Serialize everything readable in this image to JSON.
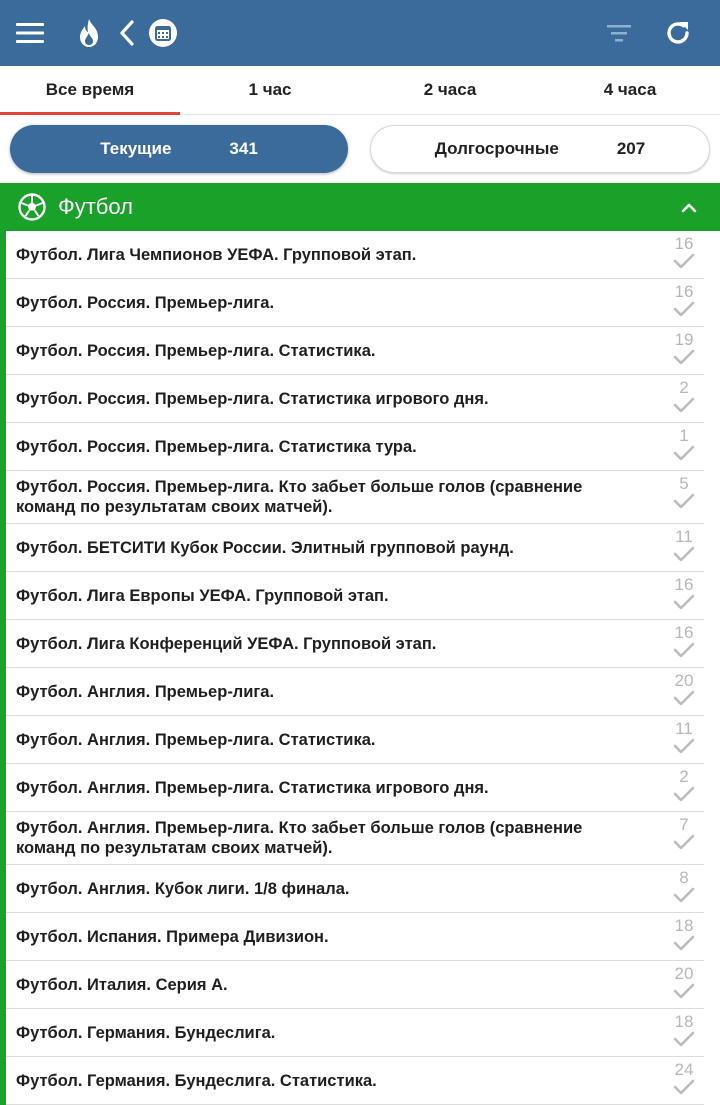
{
  "colors": {
    "header": "#3a6b9a",
    "sport": "#1aa12a",
    "accent": "#e0443a"
  },
  "topbar": {
    "icons": [
      "menu-icon",
      "flame-icon",
      "back-chevron-icon",
      "calendar-icon",
      "filter-icon",
      "refresh-icon"
    ]
  },
  "time_tabs": [
    {
      "label": "Все время",
      "active": true
    },
    {
      "label": "1 час",
      "active": false
    },
    {
      "label": "2 часа",
      "active": false
    },
    {
      "label": "4 часа",
      "active": false
    }
  ],
  "segments": [
    {
      "label": "Текущие",
      "count": "341",
      "active": true
    },
    {
      "label": "Долгосрочные",
      "count": "207",
      "active": false
    }
  ],
  "sport": {
    "name": "Футбол",
    "icon": "soccer-ball-icon",
    "expanded": true
  },
  "leagues": [
    {
      "title": "Футбол. Лига Чемпионов УЕФА. Групповой этап.",
      "count": "16"
    },
    {
      "title": "Футбол. Россия. Премьер-лига.",
      "count": "16"
    },
    {
      "title": "Футбол. Россия. Премьер-лига. Статистика.",
      "count": "19"
    },
    {
      "title": "Футбол. Россия. Премьер-лига. Статистика игрового дня.",
      "count": "2"
    },
    {
      "title": "Футбол. Россия. Премьер-лига. Статистика тура.",
      "count": "1"
    },
    {
      "title": "Футбол. Россия. Премьер-лига. Кто забьет больше голов (сравнение команд по результатам своих матчей).",
      "count": "5"
    },
    {
      "title": "Футбол. БЕТСИТИ Кубок России. Элитный групповой раунд.",
      "count": "11"
    },
    {
      "title": "Футбол. Лига Европы УЕФА. Групповой этап.",
      "count": "16"
    },
    {
      "title": "Футбол. Лига Конференций УЕФА. Групповой этап.",
      "count": "16"
    },
    {
      "title": "Футбол. Англия. Премьер-лига.",
      "count": "20"
    },
    {
      "title": "Футбол. Англия. Премьер-лига. Статистика.",
      "count": "11"
    },
    {
      "title": "Футбол. Англия. Премьер-лига. Статистика игрового дня.",
      "count": "2"
    },
    {
      "title": "Футбол. Англия. Премьер-лига. Кто забьет больше голов (сравнение команд по результатам своих матчей).",
      "count": "7"
    },
    {
      "title": "Футбол. Англия. Кубок лиги. 1/8 финала.",
      "count": "8"
    },
    {
      "title": "Футбол. Испания. Примера Дивизион.",
      "count": "18"
    },
    {
      "title": "Футбол. Италия. Серия А.",
      "count": "20"
    },
    {
      "title": "Футбол. Германия. Бундеслига.",
      "count": "18"
    },
    {
      "title": "Футбол. Германия. Бундеслига. Статистика.",
      "count": "24"
    }
  ]
}
